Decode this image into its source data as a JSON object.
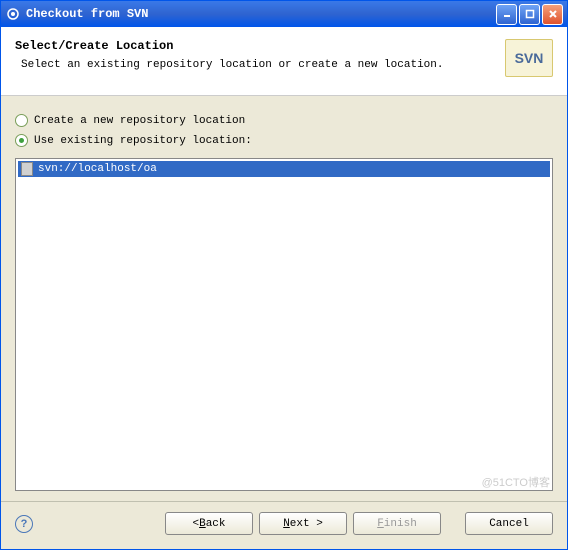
{
  "titlebar": {
    "text": "Checkout from SVN"
  },
  "header": {
    "title": "Select/Create Location",
    "description": "Select an existing repository location or create a new location."
  },
  "logo": {
    "text": "SVN"
  },
  "options": {
    "create": "Create a new repository location",
    "use": "Use existing repository location:"
  },
  "locations": [
    {
      "url": "svn://localhost/oa"
    }
  ],
  "buttons": {
    "back_prefix": "< ",
    "back": "B",
    "back_suffix": "ack",
    "next": "N",
    "next_suffix": "ext >",
    "finish_prefix": "",
    "finish": "F",
    "finish_suffix": "inish",
    "cancel": "Cancel"
  },
  "help": "?",
  "watermark": "@51CTO博客"
}
